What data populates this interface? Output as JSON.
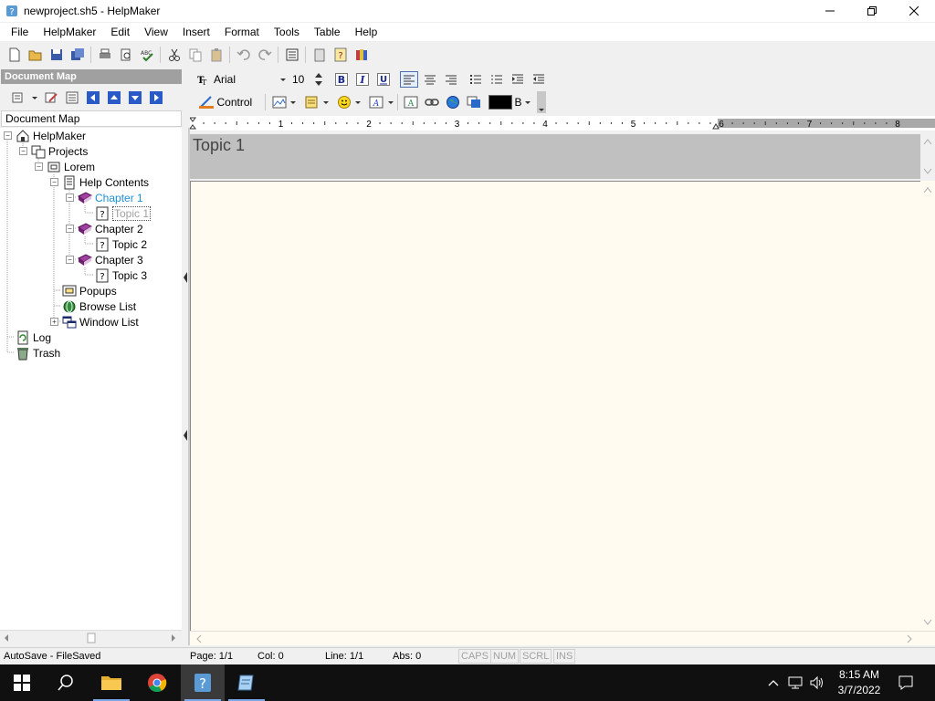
{
  "window": {
    "title": "newproject.sh5 - HelpMaker"
  },
  "menu": {
    "items": [
      "File",
      "HelpMaker",
      "Edit",
      "View",
      "Insert",
      "Format",
      "Tools",
      "Table",
      "Help"
    ]
  },
  "document_map": {
    "header": "Document Map",
    "title": "Document Map",
    "tree": [
      {
        "label": "HelpMaker"
      },
      {
        "label": "Projects"
      },
      {
        "label": "Lorem"
      },
      {
        "label": "Help Contents"
      },
      {
        "label": "Chapter 1"
      },
      {
        "label": "Topic 1"
      },
      {
        "label": "Chapter 2"
      },
      {
        "label": "Topic 2"
      },
      {
        "label": "Chapter 3"
      },
      {
        "label": "Topic 3"
      },
      {
        "label": "Popups"
      },
      {
        "label": "Browse List"
      },
      {
        "label": "Window List"
      },
      {
        "label": "Log"
      },
      {
        "label": "Trash"
      }
    ]
  },
  "format": {
    "font": "Arial",
    "size": "10",
    "control_label": "Control",
    "bold_letter": "B",
    "color": "#000000"
  },
  "ruler": {
    "marks": [
      "1",
      "2",
      "3",
      "4",
      "5",
      "6",
      "7",
      "8"
    ]
  },
  "topic": {
    "title": "Topic 1"
  },
  "status": {
    "autosave": "AutoSave - FileSaved",
    "page": "Page: 1/1",
    "col": "Col: 0",
    "line": "Line: 1/1",
    "abs": "Abs: 0",
    "caps": "CAPS",
    "num": "NUM",
    "scrl": "SCRL",
    "ins": "INS"
  },
  "taskbar": {
    "time": "8:15 AM",
    "date": "3/7/2022"
  },
  "colors": {
    "editor_bg": "#fffbf0",
    "topic_header_bg": "#c0c0c0",
    "selected_text": "#1a8fd6",
    "panel_header": "#a0a0a0"
  }
}
